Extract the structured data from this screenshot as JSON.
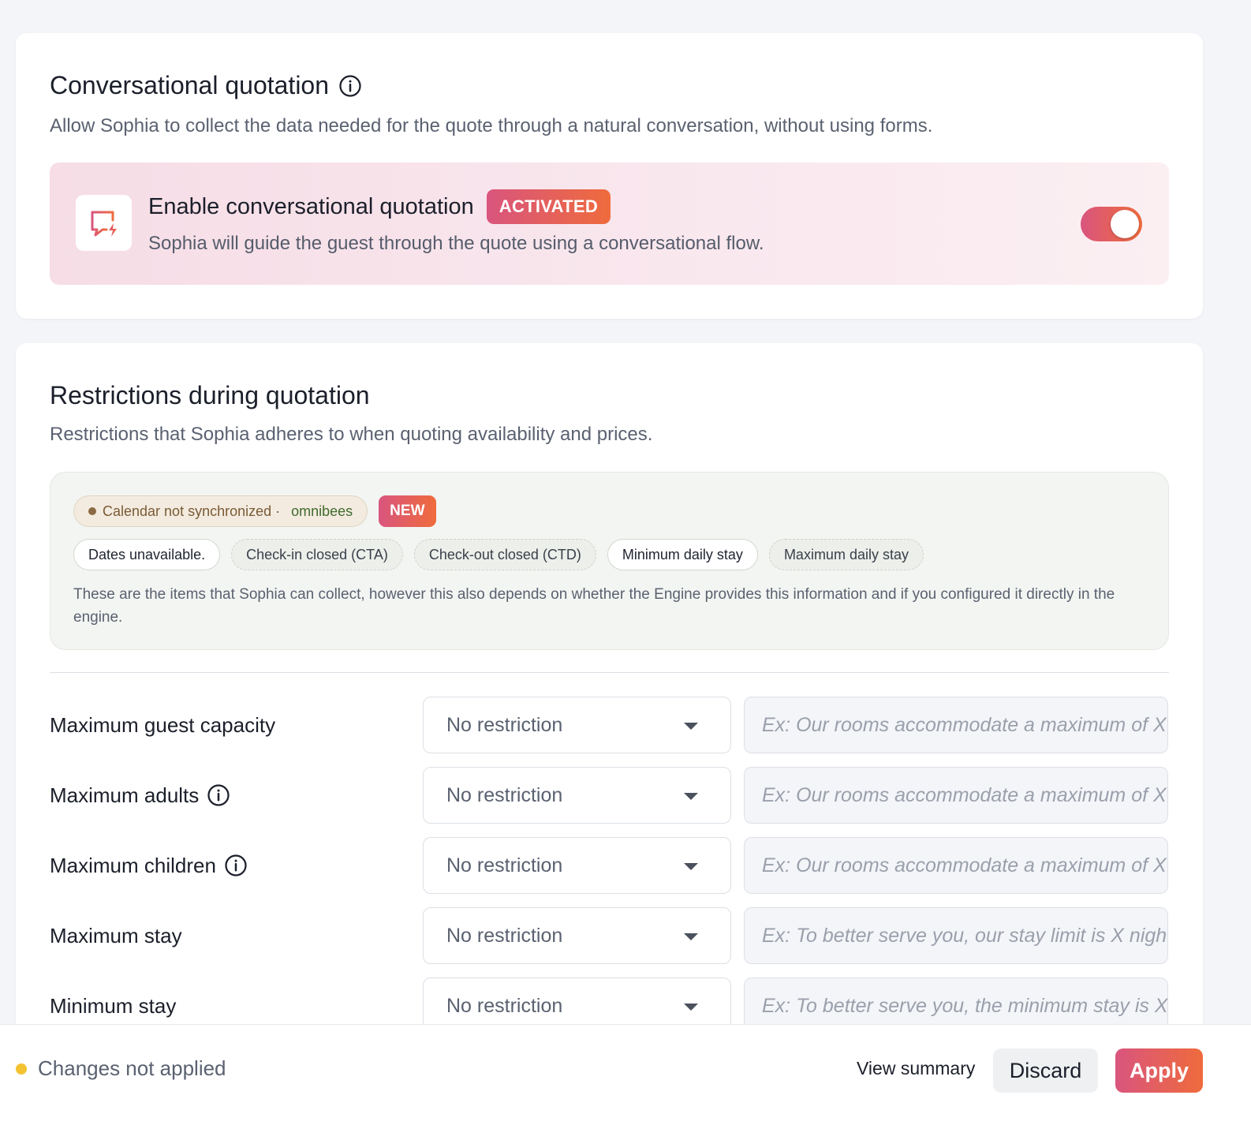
{
  "conversational": {
    "title": "Conversational quotation",
    "subtitle": "Allow Sophia to collect the data needed for the quote through a natural conversation, without using forms.",
    "enable": {
      "title": "Enable conversational quotation",
      "badge": "ACTIVATED",
      "description": "Sophia will guide the guest through the quote using a conversational flow.",
      "toggle_on": true,
      "icon": "chat-flash-icon"
    }
  },
  "restrictions": {
    "title": "Restrictions during quotation",
    "subtitle": "Restrictions that Sophia adheres to when quoting availability and prices.",
    "calendar_status": "Calendar not synchronized ·",
    "provider": "omnibees",
    "new_badge": "NEW",
    "items": [
      "Dates unavailable.",
      "Check-in closed (CTA)",
      "Check-out closed (CTD)",
      "Minimum daily stay",
      "Maximum daily stay"
    ],
    "note": "These are the items that Sophia can collect, however this also depends on whether the Engine provides this information and if you configured it directly in the engine.",
    "rows": [
      {
        "label": "Maximum guest capacity",
        "value": "No restriction",
        "placeholder": "Ex: Our rooms accommodate a maximum of X guests"
      },
      {
        "label": "Maximum adults",
        "value": "No restriction",
        "placeholder": "Ex: Our rooms accommodate a maximum of X adults"
      },
      {
        "label": "Maximum children",
        "value": "No restriction",
        "placeholder": "Ex: Our rooms accommodate a maximum of X children"
      },
      {
        "label": "Maximum stay",
        "value": "No restriction",
        "placeholder": "Ex: To better serve you, our stay limit is X nights"
      },
      {
        "label": "Minimum stay",
        "value": "No restriction",
        "placeholder": "Ex: To better serve you, the minimum stay is X nights"
      }
    ]
  },
  "footer": {
    "status": "Changes not applied",
    "view_summary": "View summary",
    "discard": "Discard",
    "apply": "Apply"
  },
  "colors": {
    "accent_start": "#d9557e",
    "accent_end": "#ef6b3c",
    "status_dot": "#f2c230"
  }
}
